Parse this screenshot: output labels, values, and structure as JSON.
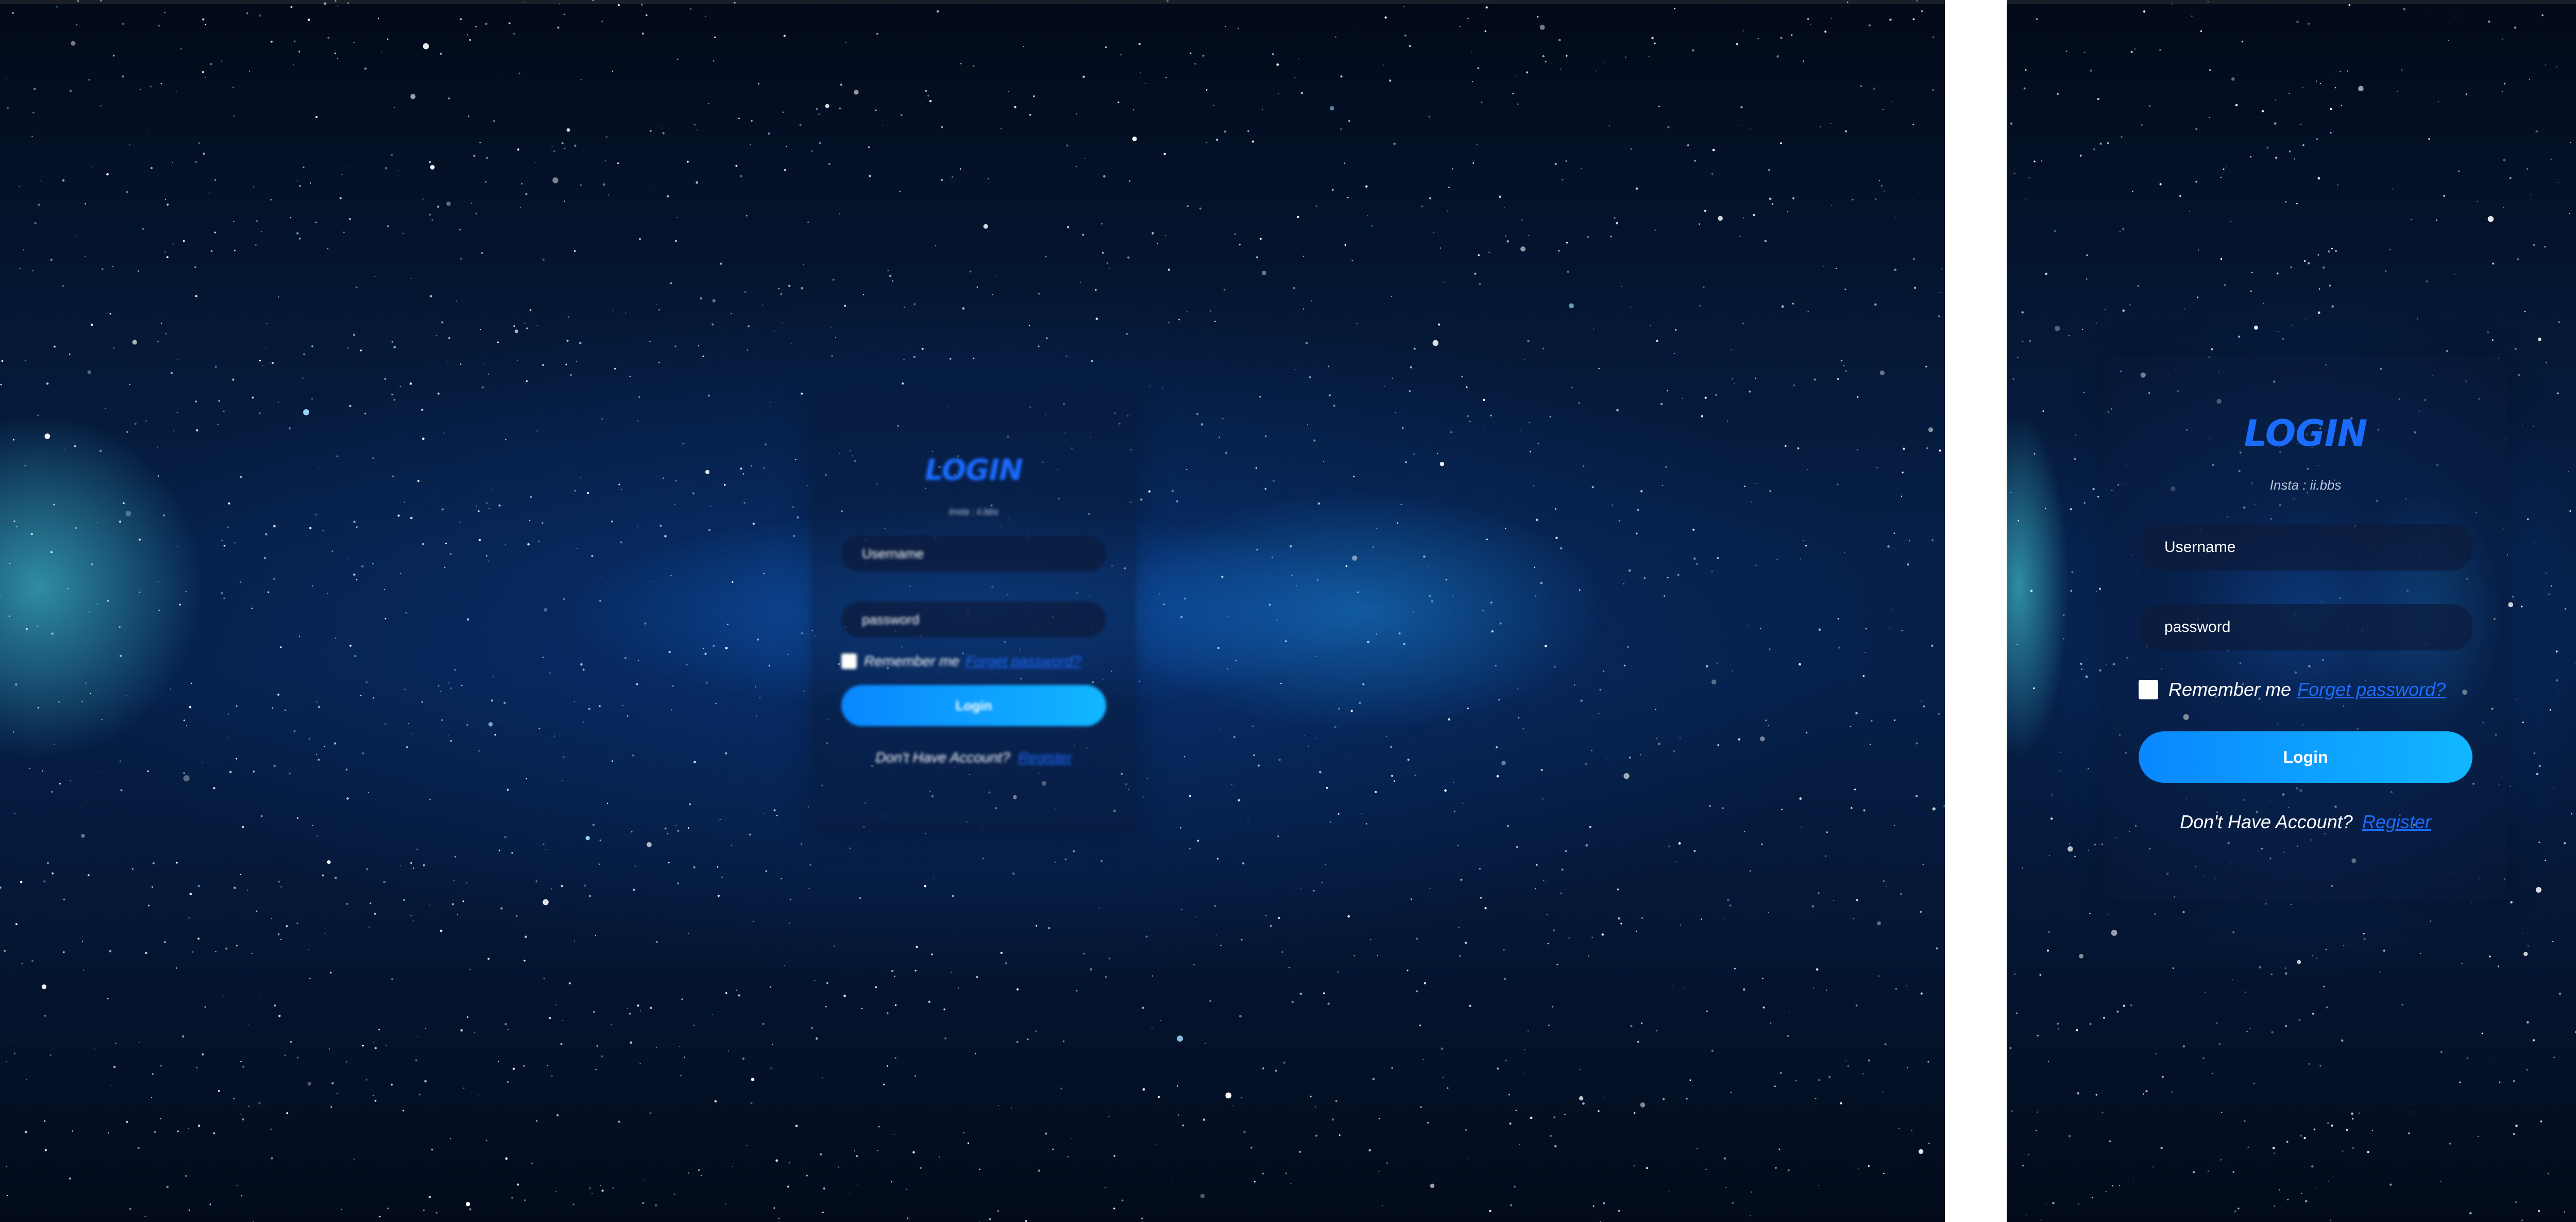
{
  "login": {
    "title": "LOGIN",
    "subtitle": "Insta : ii.bbs",
    "username_placeholder": "Username",
    "password_placeholder": "password",
    "remember_label": "Remember me",
    "forgot_link": "Forget password?",
    "login_button": "Login",
    "no_account_text": "Don't Have Account?",
    "register_link": "Register"
  },
  "colors": {
    "accent": "#1a6cff",
    "button_start": "#0a87ff",
    "button_end": "#11b7ff",
    "background_dark": "#030a18"
  }
}
